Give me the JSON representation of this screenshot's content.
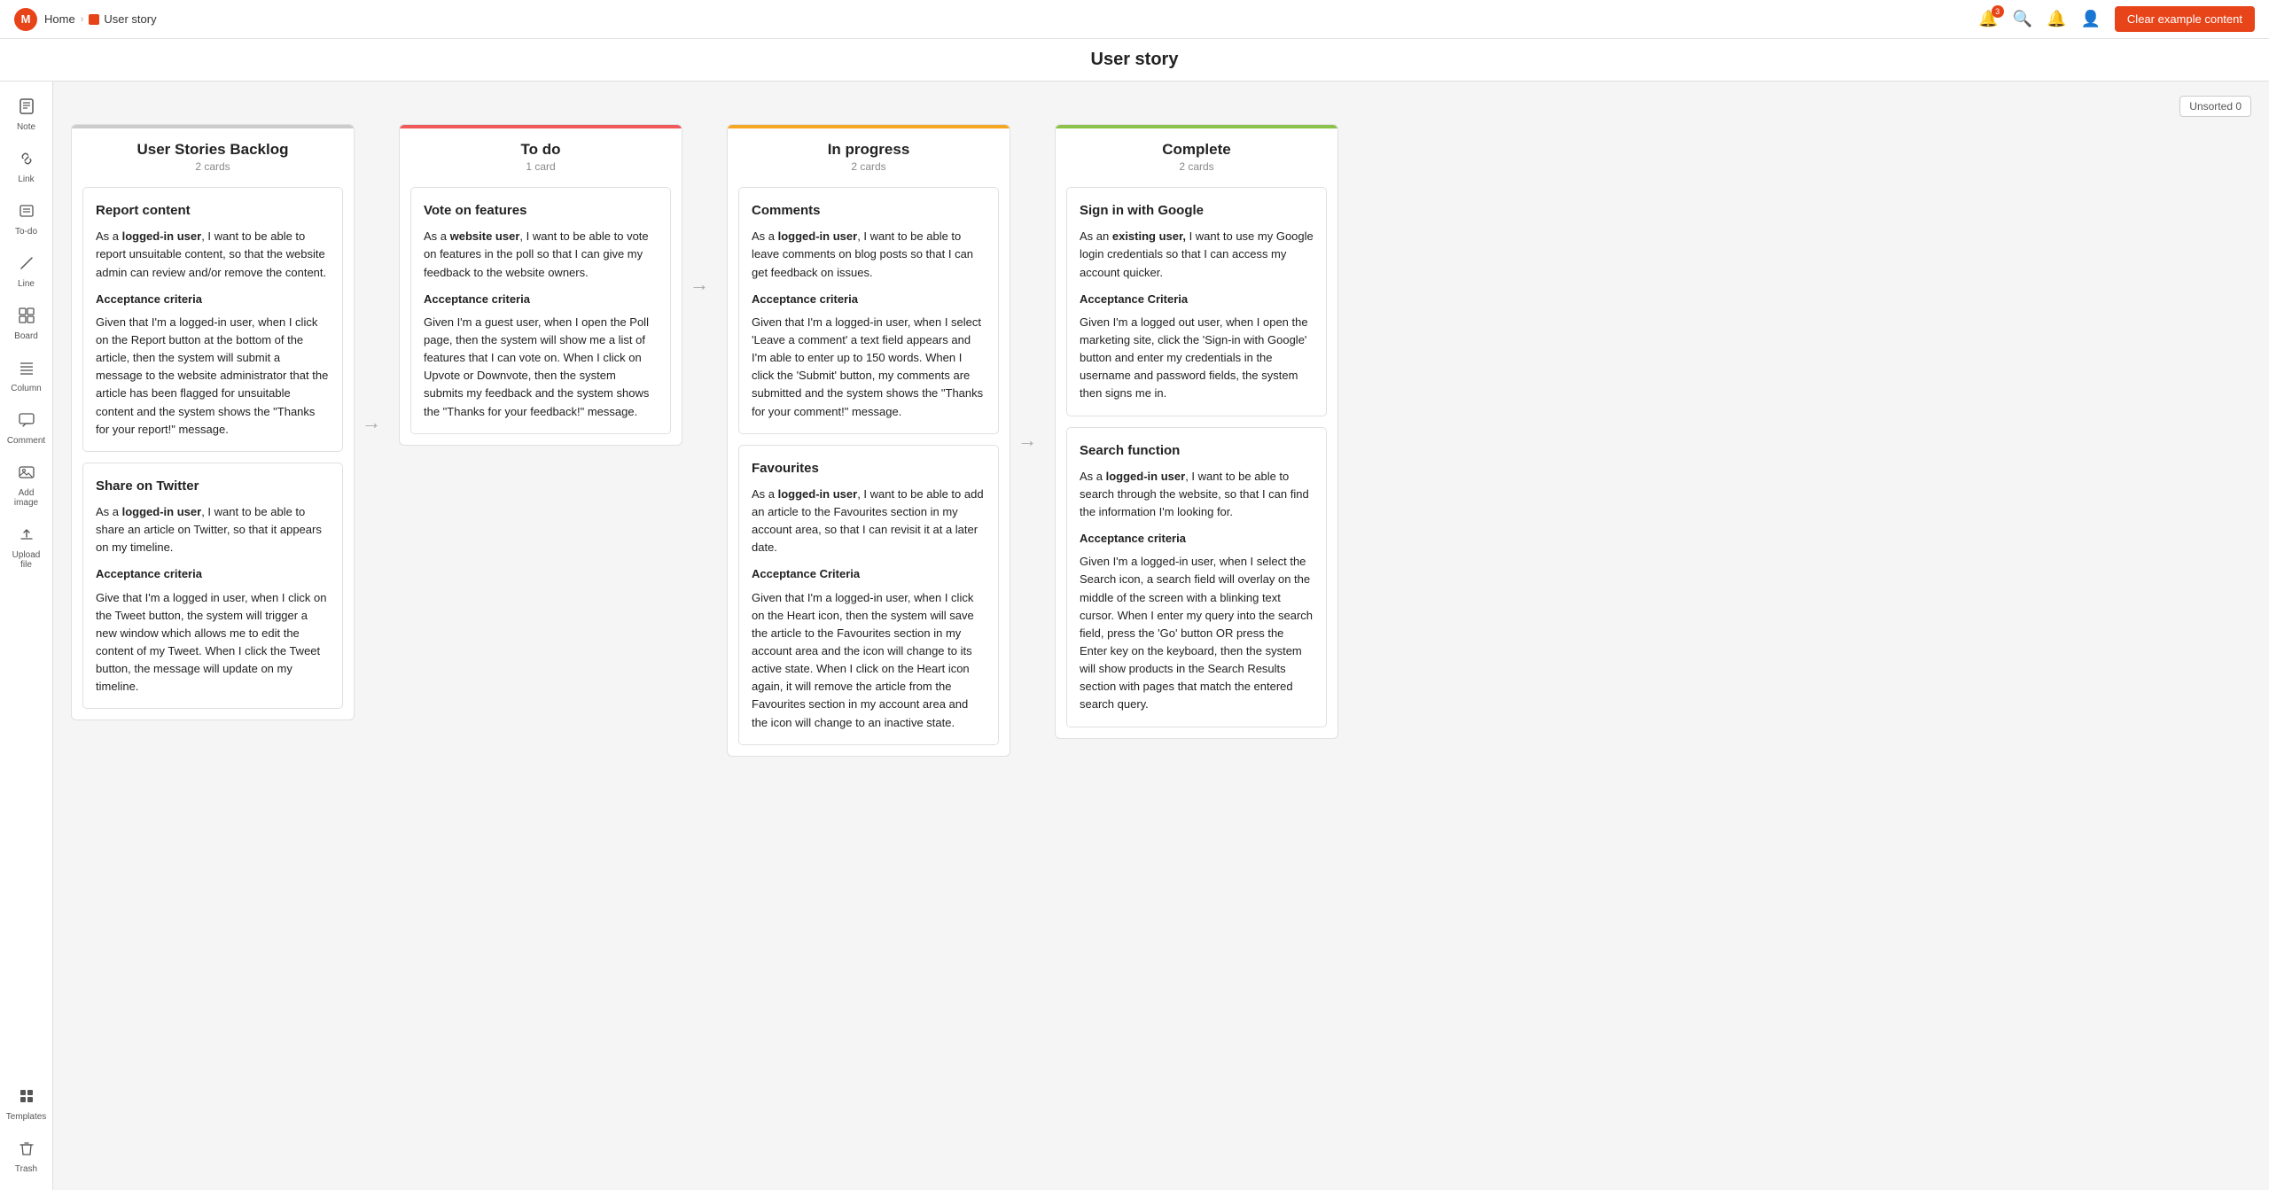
{
  "topbar": {
    "logo_text": "M",
    "breadcrumb_home": "Home",
    "breadcrumb_sep": "›",
    "breadcrumb_current": "User story",
    "badge_count": "3",
    "clear_button": "Clear example content"
  },
  "page_title": "User story",
  "unsorted_label": "Unsorted 0",
  "sidebar": {
    "items": [
      {
        "id": "note",
        "label": "Note",
        "icon": "📝"
      },
      {
        "id": "link",
        "label": "Link",
        "icon": "🔗"
      },
      {
        "id": "todo",
        "label": "To-do",
        "icon": "☑"
      },
      {
        "id": "line",
        "label": "Line",
        "icon": "✏"
      },
      {
        "id": "board",
        "label": "Board",
        "icon": "⊞"
      },
      {
        "id": "column",
        "label": "Column",
        "icon": "☰"
      },
      {
        "id": "comment",
        "label": "Comment",
        "icon": "💬"
      },
      {
        "id": "addimage",
        "label": "Add image",
        "icon": "🖼"
      },
      {
        "id": "upload",
        "label": "Upload file",
        "icon": "⬆"
      },
      {
        "id": "templates",
        "label": "Templates",
        "icon": "⬛"
      },
      {
        "id": "trash",
        "label": "Trash",
        "icon": "🗑"
      }
    ]
  },
  "columns": [
    {
      "id": "backlog",
      "title": "User Stories Backlog",
      "count": "2 cards",
      "border_color": "#cccccc",
      "cards": [
        {
          "id": "report-content",
          "title": "Report content",
          "body": "As a <b>logged-in user</b>, I want to be able to report unsuitable content, so that the website admin can review and/or remove the content.",
          "section_title": "Acceptance criteria",
          "section_body": "Given that I'm a logged-in user, when I click on the Report button at the bottom of the article, then the system will submit a message to the website administrator that the article has been flagged for unsuitable content and the system shows the \"Thanks for your report!\" message."
        },
        {
          "id": "share-twitter",
          "title": "Share on Twitter",
          "body": "As a <b>logged-in user</b>, I want to be able to share an article on Twitter, so that it appears on my timeline.",
          "section_title": "Acceptance criteria",
          "section_body": "Give that I'm a logged in user, when I click on the Tweet button, the system will trigger a new window which allows me to edit the content of my Tweet. When I click the Tweet button, the message will update on my timeline."
        }
      ]
    },
    {
      "id": "todo",
      "title": "To do",
      "count": "1 card",
      "border_color": "#f05a5a",
      "cards": [
        {
          "id": "vote-features",
          "title": "Vote on features",
          "body": "As a <b>website user</b>, I want to be able to vote on features in the poll so that I can give my feedback to the website owners.",
          "section_title": "Acceptance criteria",
          "section_body": "Given I'm a guest user, when I open the Poll page, then the system will show me a list of features that I can vote on. When I click on Upvote or Downvote, then the system submits my feedback and the system shows the \"Thanks for your feedback!\" message."
        }
      ]
    },
    {
      "id": "in-progress",
      "title": "In progress",
      "count": "2 cards",
      "border_color": "#f5a623",
      "cards": [
        {
          "id": "comments",
          "title": "Comments",
          "body": "As a <b>logged-in user</b>, I want to be able to leave comments on blog posts so that I can get feedback on issues.",
          "section_title": "Acceptance criteria",
          "section_body": "Given that I'm a logged-in user, when I select 'Leave a comment' a text field appears and I'm able to enter up to 150 words. When I click the 'Submit' button, my comments are submitted and the system shows the \"Thanks for your comment!\" message."
        },
        {
          "id": "favourites",
          "title": "Favourites",
          "body": "As a <b>logged-in user</b>, I want to be able to add an article to the Favourites section in my account area, so that I can revisit it at a later date.",
          "section_title": "Acceptance Criteria",
          "section_body": "Given that I'm a logged-in user, when I click on the Heart icon, then the system will save the article to the Favourites section in my account area and the icon will change to its active state. When I click on the Heart icon again, it will remove the article from the Favourites section in my account area and the icon will change to an inactive state."
        }
      ]
    },
    {
      "id": "complete",
      "title": "Complete",
      "count": "2 cards",
      "border_color": "#8bc34a",
      "cards": [
        {
          "id": "sign-in-google",
          "title": "Sign in with Google",
          "body": "As an <b>existing user,</b> I want to use my Google login credentials so that I can access my account quicker.",
          "section_title": "Acceptance Criteria",
          "section_body": "Given I'm a logged out user, when I open the marketing site, click the 'Sign-in with Google' button and enter my credentials in the username and password fields, the system then signs me in."
        },
        {
          "id": "search-function",
          "title": "Search function",
          "body": "As a <b>logged-in user</b>, I want to be able to search through the website, so that I can find the information I'm looking for.",
          "section_title": "Acceptance criteria",
          "section_body": "Given I'm a logged-in user, when I select the Search icon, a search field will overlay on the middle of the screen with a blinking text cursor. When I enter my query into the search field, press the 'Go' button OR press the Enter key on the keyboard, then the system will show products in the Search Results section with pages that match the entered search query."
        }
      ]
    }
  ]
}
